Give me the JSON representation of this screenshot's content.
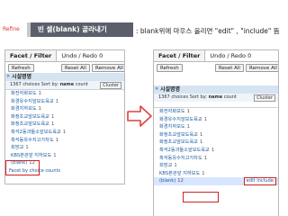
{
  "header": {
    "tag": "Refine",
    "title": "빈 셀(blank) 골라내기",
    "subtitle": ": blank위에 마우스 올리면 \"edit\" , \"include\" 뜸"
  },
  "panel": {
    "tab_facet": "Facet / Filter",
    "tab_undo": "Undo / Redo",
    "tab_undo_count": "0",
    "btn_refresh": "Refresh",
    "btn_reset": "Reset All",
    "btn_remove": "Remove All",
    "facet_name": "시설명명",
    "count_text": "1367 choices Sort by:",
    "sort_name": "name",
    "sort_count": "count",
    "cluster": "Cluster",
    "facet_by_counts": "Facet by choice counts"
  },
  "left_items": [
    {
      "label": "화전자화보도",
      "n": "1"
    },
    {
      "label": "화경유수지앞보도육교",
      "n": "1"
    },
    {
      "label": "화경지하보도",
      "n": "1"
    },
    {
      "label": "화정초교앞보도육교",
      "n": "1"
    },
    {
      "label": "화정초교앞보도육교",
      "n": "1"
    },
    {
      "label": "흑석2동과들소앞보도육교",
      "n": "1"
    },
    {
      "label": "흑석동유수지고가차도",
      "n": "1"
    },
    {
      "label": "회망교",
      "n": "1"
    },
    {
      "label": "KBS본관앞 지하보도",
      "n": "1"
    },
    {
      "label": "(blank)",
      "n": "12"
    }
  ],
  "right_items": [
    {
      "label": "화전자화보도",
      "n": "1"
    },
    {
      "label": "화경유수지앞보도육교",
      "n": "1"
    },
    {
      "label": "화경지하보도",
      "n": "1"
    },
    {
      "label": "화정초교앞보도육교",
      "n": "1"
    },
    {
      "label": "화정초교앞보도육교",
      "n": "1"
    },
    {
      "label": "흑석2동과들소앞보도육교",
      "n": "1"
    },
    {
      "label": "흑석동유수지고가차도",
      "n": "1"
    },
    {
      "label": "회망교",
      "n": "1"
    },
    {
      "label": "KBS본관앞 지하보도",
      "n": "1"
    },
    {
      "label": "(blank)",
      "n": "12"
    }
  ],
  "hover_actions": "edit include",
  "colors": {
    "title_bg": "#5a5f6a",
    "accent_red": "#d02020",
    "arrow_red": "#e04040",
    "facet_header_bg": "#d6e4f2",
    "link_blue": "#1a5aa0"
  }
}
